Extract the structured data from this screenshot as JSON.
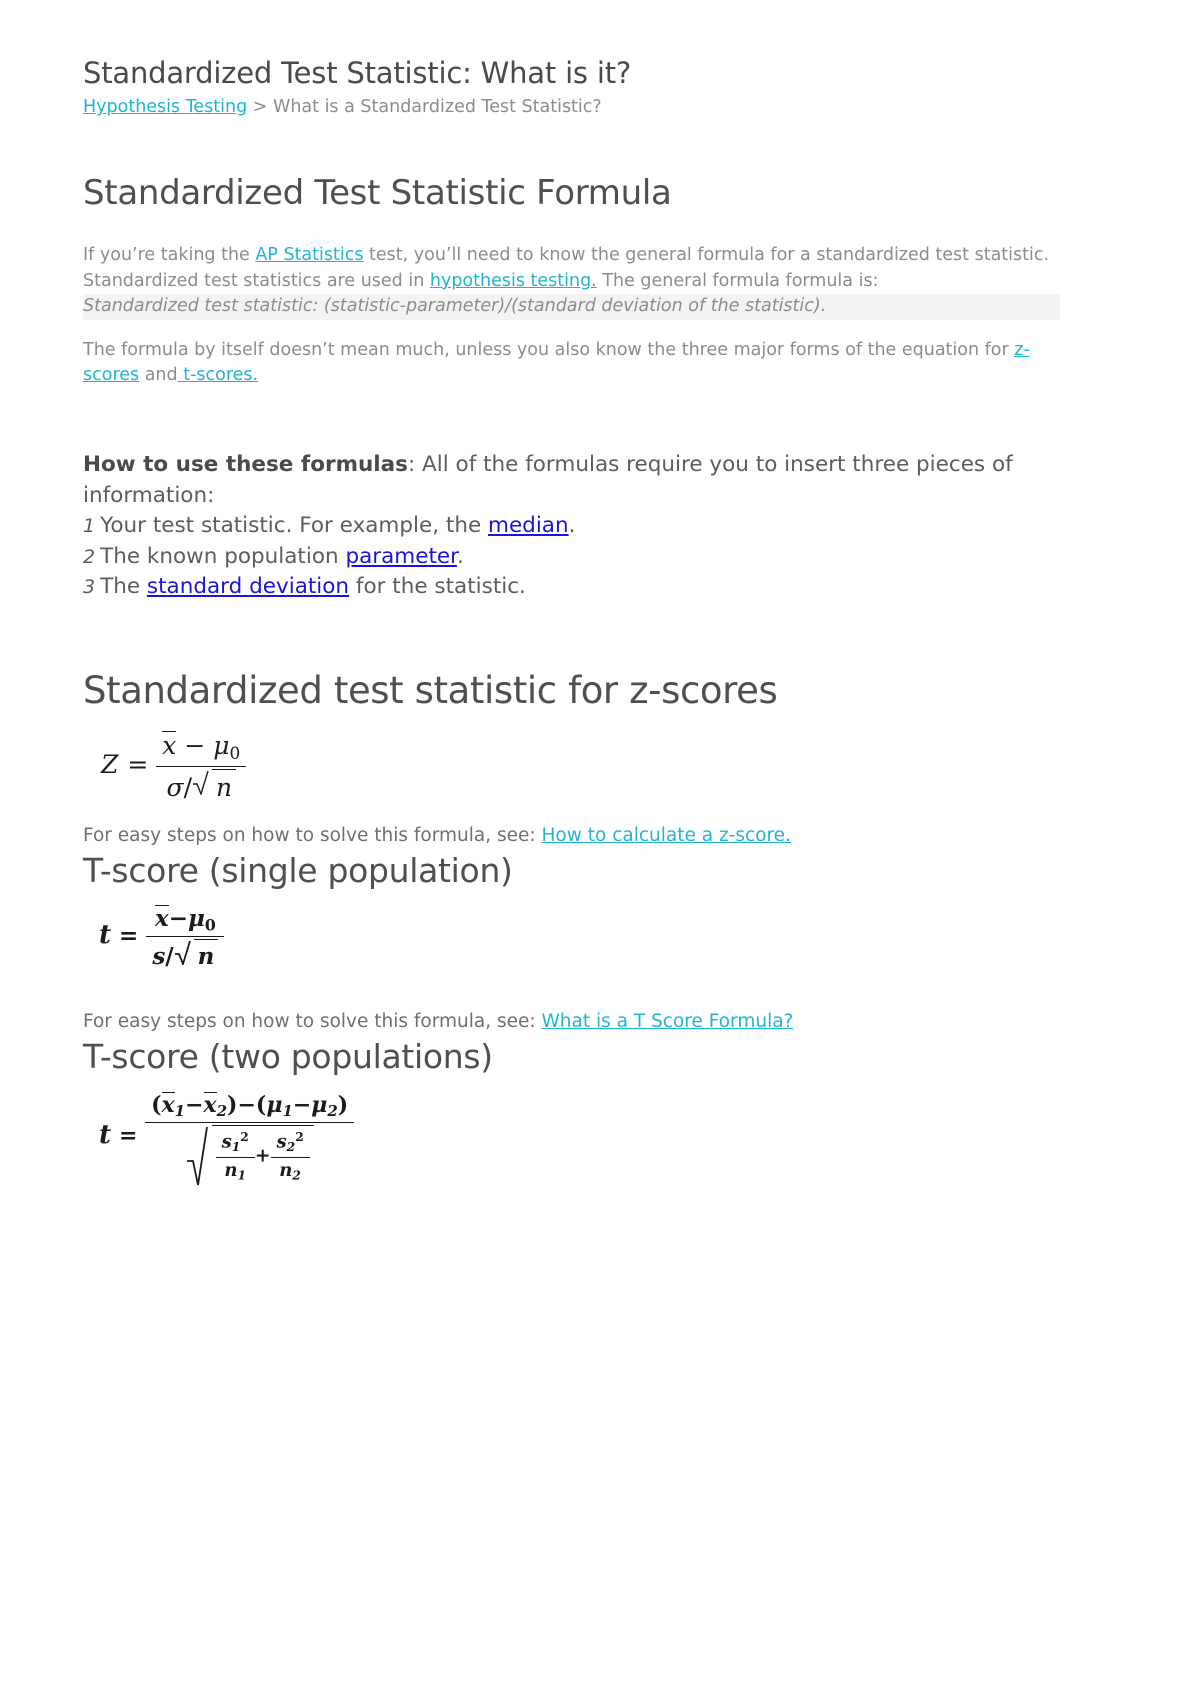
{
  "document": {
    "title": "Standardized Test Statistic: What is it?",
    "breadcrumb": {
      "link_text": "Hypothesis Testing",
      "separator": " > ",
      "current": "What is a Standardized Test Statistic?"
    },
    "section_formula": {
      "heading": "Standardized Test Statistic Formula",
      "paragraph1": {
        "part1": "If you’re taking the ",
        "link1": "AP Statistics",
        "part2": " test, you’ll need to know the general formula for a standardized test statistic. Standardized test statistics are used in ",
        "link2": "hypothesis testing.",
        "part3": " The general formula formula is:"
      },
      "italic_formula": "Standardized test statistic: (statistic-parameter)/(standard deviation of the statistic).",
      "paragraph2": {
        "part1": "The formula by itself doesn’t mean much, unless you also know the three major forms of the equation for ",
        "link1": "z-scores",
        "part2": " and",
        "link2": " t-scores.",
        "part3": ""
      }
    },
    "howto": {
      "bold_label": "How to use these formulas",
      "intro": ": All of the formulas require you to insert three pieces of information:",
      "items": [
        {
          "number": "1",
          "pre": "Your test statistic. For example, the ",
          "link": "median",
          "post": "."
        },
        {
          "number": "2",
          "pre": "The known population ",
          "link": "parameter",
          "post": "."
        },
        {
          "number": "3",
          "pre": "The ",
          "link": "standard deviation",
          "post": " for the statistic."
        }
      ]
    },
    "zscore_section": {
      "heading": "Standardized test statistic for z-scores",
      "formula_alt": "Z = (x̄ − μ₀) / (σ / √n)",
      "formula": {
        "lhs": "Z",
        "equals": "=",
        "numerator_mean": "x",
        "numerator_minus": "−",
        "numerator_mu": "μ",
        "numerator_mu_sub": "0",
        "denominator_sigma": "σ",
        "denominator_slash": "/",
        "denominator_sqrt": "n"
      },
      "see_also": {
        "pre": "For easy steps on how to solve this formula, see: ",
        "link": "How to calculate a z-score."
      }
    },
    "tscore_single": {
      "heading": "T-score (single population)",
      "formula_alt": "t = (x̄ − μ₀) / (s / √n)",
      "formula": {
        "lhs": "t",
        "equals": "=",
        "numerator_mean": "x",
        "numerator_minus": "−",
        "numerator_mu": "μ",
        "numerator_mu_sub": "0",
        "denominator_s": "s",
        "denominator_slash": "/",
        "denominator_sqrt": "n"
      },
      "see_also": {
        "pre": "For easy steps on how to solve this formula, see: ",
        "link": "What is a T Score Formula?"
      }
    },
    "tscore_two": {
      "heading": "T-score (two populations)",
      "formula_alt": "t = ((x̄₁ − x̄₂) − (μ₁ − μ₂)) / √(s₁²/n₁ + s₂²/n₂)",
      "formula": {
        "lhs": "t",
        "equals": "=",
        "x1": "x",
        "x1_sub": "1",
        "minus1": "−",
        "x2": "x",
        "x2_sub": "2",
        "minus_mid": "−",
        "mu1": "μ",
        "mu1_sub": "1",
        "minus2": "−",
        "mu2": "μ",
        "mu2_sub": "2",
        "s1": "s",
        "s1_sub": "1",
        "s1_sup": "2",
        "n1": "n",
        "n1_sub": "1",
        "plus": "+",
        "s2": "s",
        "s2_sub": "2",
        "s2_sup": "2",
        "n2": "n",
        "n2_sub": "2"
      }
    },
    "colors": {
      "teal_link": "#1eb5d0",
      "blue_link": "#1a16d8",
      "body_text": "#8c8c8c",
      "heading_text": "#4f4f4f",
      "highlight_bg": "#f3f3f3"
    }
  }
}
